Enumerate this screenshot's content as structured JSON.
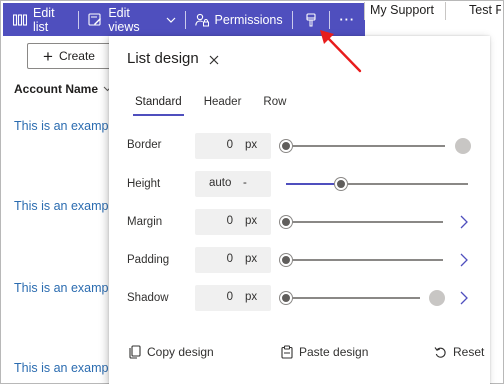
{
  "command_bar": {
    "edit_list": "Edit list",
    "edit_views": "Edit views",
    "permissions": "Permissions",
    "more": "···",
    "accent": "#4f4fbe"
  },
  "columns": {
    "col1": "My Support",
    "col2": "Test Fo"
  },
  "list": {
    "create_label": "Create",
    "account_header": "Account Name",
    "rows": [
      "This is an examp",
      "This is an examp",
      "This is an examp",
      "This is an examp"
    ]
  },
  "panel": {
    "title": "List design",
    "tabs": [
      "Standard",
      "Header",
      "Row"
    ],
    "active_tab": "Standard",
    "properties": [
      {
        "label": "Border",
        "value": "0",
        "unit": "px",
        "level": 0.0
      },
      {
        "label": "Height",
        "value": "auto",
        "unit": "-",
        "level": 0.3
      },
      {
        "label": "Margin",
        "value": "0",
        "unit": "px",
        "level": 0.0
      },
      {
        "label": "Padding",
        "value": "0",
        "unit": "px",
        "level": 0.0
      },
      {
        "label": "Shadow",
        "value": "0",
        "unit": "px",
        "level": 0.0
      }
    ],
    "footer": {
      "copy": "Copy design",
      "paste": "Paste design",
      "reset": "Reset"
    }
  },
  "annotation_color": "#e81c1c"
}
